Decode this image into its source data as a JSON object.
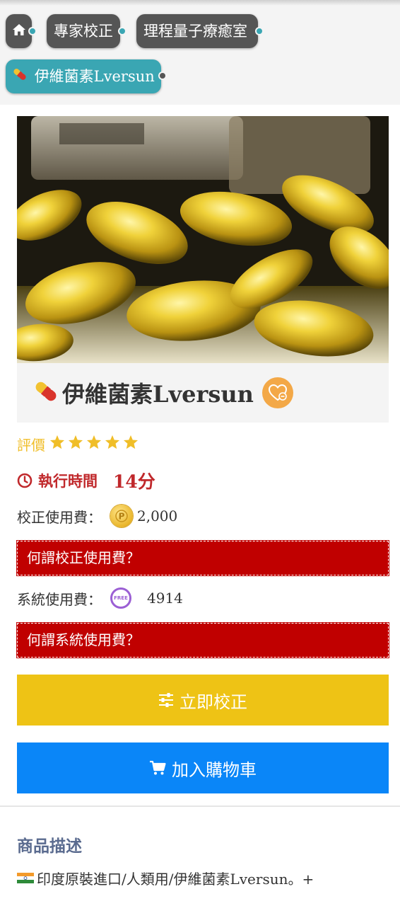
{
  "breadcrumb": {
    "home_icon": "home-icon",
    "items": [
      {
        "label": "專家校正"
      },
      {
        "label": "理程量子療癒室"
      },
      {
        "label": "伊維菌素Lversun",
        "icon": "pill-icon"
      }
    ]
  },
  "product": {
    "image_icon": "capsules-photo",
    "title": "伊維菌素Lversun",
    "title_icon": "pill-icon",
    "favorite_icon": "heart-minus-icon",
    "rating_label": "評價",
    "stars": 5,
    "exec_label": "執行時間",
    "exec_value": "14分",
    "calib_fee_label": "校正使用費：",
    "calib_fee_value": "2,000",
    "calib_fee_help": "何謂校正使用費？",
    "system_fee_label": "系統使用費：",
    "system_fee_coin": "FREE",
    "system_fee_value": "4914",
    "system_fee_help": "何謂系統使用費？"
  },
  "actions": {
    "calibrate_label": "立即校正",
    "cart_label": "加入購物車"
  },
  "description": {
    "title": "商品描述",
    "text": "印度原裝進口/人類用/伊維菌素Lversun。+",
    "flag_icon": "india-flag-icon"
  },
  "colors": {
    "accent_teal": "#3aa6b3",
    "alert_red": "#c00000",
    "gold_button": "#eec315",
    "blue_button": "#0a86f8",
    "star_color": "#f0be28"
  }
}
